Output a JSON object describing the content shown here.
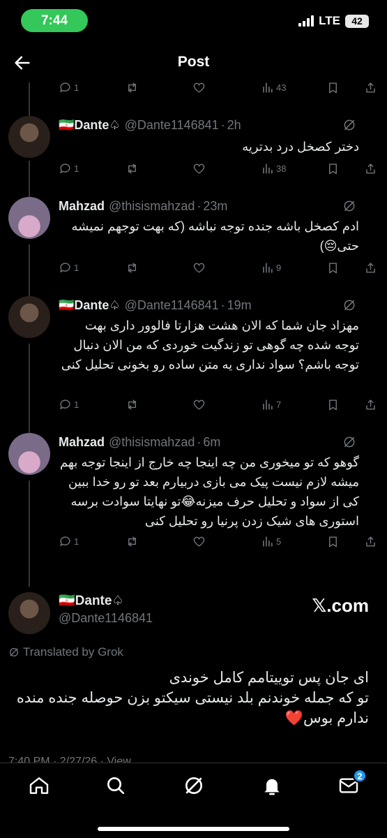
{
  "status_bar": {
    "time": "7:44",
    "network": "LTE",
    "battery": "42"
  },
  "header": {
    "title": "Post"
  },
  "top_actions": {
    "replies": "1",
    "views": "43"
  },
  "tweets": [
    {
      "name": "🇮🇷Dante♤",
      "handle": "@Dante1146841",
      "time": "2h",
      "text": "دختر کصخل درد بدتریه",
      "replies": "1",
      "views": "38"
    },
    {
      "name": "Mahzad",
      "handle": "@thisismahzad",
      "time": "23m",
      "text": "ادم کصخل باشه جنده توجه نباشه (که بهت توجهم نمیشه حتی😔)",
      "replies": "1",
      "views": "9"
    },
    {
      "name": "🇮🇷Dante♤",
      "handle": "@Dante1146841",
      "time": "19m",
      "text": "مهزاد جان شما که الان هشت هزارتا فالوور داری بهت توجه شده چه گوهی تو زندگیت خوردی که من الان دنبال توجه باشم؟ سواد نداری یه متن ساده رو بخونی تحلیل کنی",
      "replies": "1",
      "views": "7"
    },
    {
      "name": "Mahzad",
      "handle": "@thisismahzad",
      "time": "6m",
      "text": "گوهو که تو میخوری من چه اینجا چه خارج از اینجا توجه بهم میشه لازم نیست پیک می بازی دربیارم بعد تو رو خدا ببین کی از سواد و تحلیل حرف میزنه😂تو نهایتا سوادت برسه استوری های شیک زدن پرنیا رو تحلیل کنی",
      "replies": "1",
      "views": "5"
    }
  ],
  "main_tweet": {
    "name": "🇮🇷Dante♤",
    "handle": "@Dante1146841",
    "source": "𝕏.com",
    "translated_label": "Translated by Grok",
    "text_line1": "ای جان پس توییتامم کامل خوندی",
    "text_line2": "تو که جمله خوندنم بلد نیستی سیکتو بزن حوصله جنده منده ندارم بوس❤️",
    "meta": "7:40 PM · 2/27/26 · View"
  },
  "bottom_nav": {
    "messages_badge": "2"
  }
}
